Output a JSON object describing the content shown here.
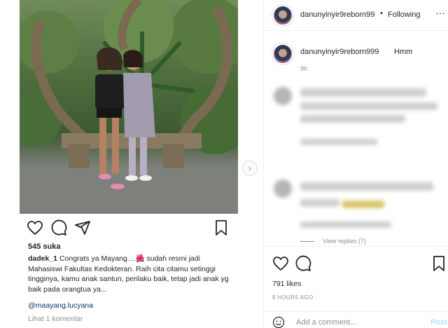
{
  "left_post": {
    "likes": "545 suka",
    "caption_user": "dadek_1",
    "caption_text": " Congrats ya Mayang....🌺 sudah resmi jadi Mahasiswi Fakultas Kedokteran. Raih cita citamu setinggi tingginya, kamu anak santun, perilaku baik, tetap jadi anak yg baik pada orangtua ya...",
    "mention": "@maayang.lucyana",
    "view_comments": "Lihat 1 komentar"
  },
  "next_arrow": "›",
  "header": {
    "username": "danunyinyir9reborn99",
    "dot": "•",
    "following": "Following",
    "more": "···"
  },
  "first_comment": {
    "username": "danunyinyir9reborn999",
    "text": "Hmm",
    "time": "9h"
  },
  "view_replies": "View replies (7)",
  "right_footer": {
    "likes": "791 likes",
    "ago": "9 HOURS AGO",
    "add_comment_placeholder": "Add a comment...",
    "post_label": "Post"
  },
  "icons": [
    "heart-icon",
    "comment-icon",
    "share-icon",
    "bookmark-icon",
    "emoji-icon"
  ],
  "colors": {
    "link": "#00376b",
    "muted": "#8e8e8e",
    "post_disabled": "#b2dffc"
  }
}
